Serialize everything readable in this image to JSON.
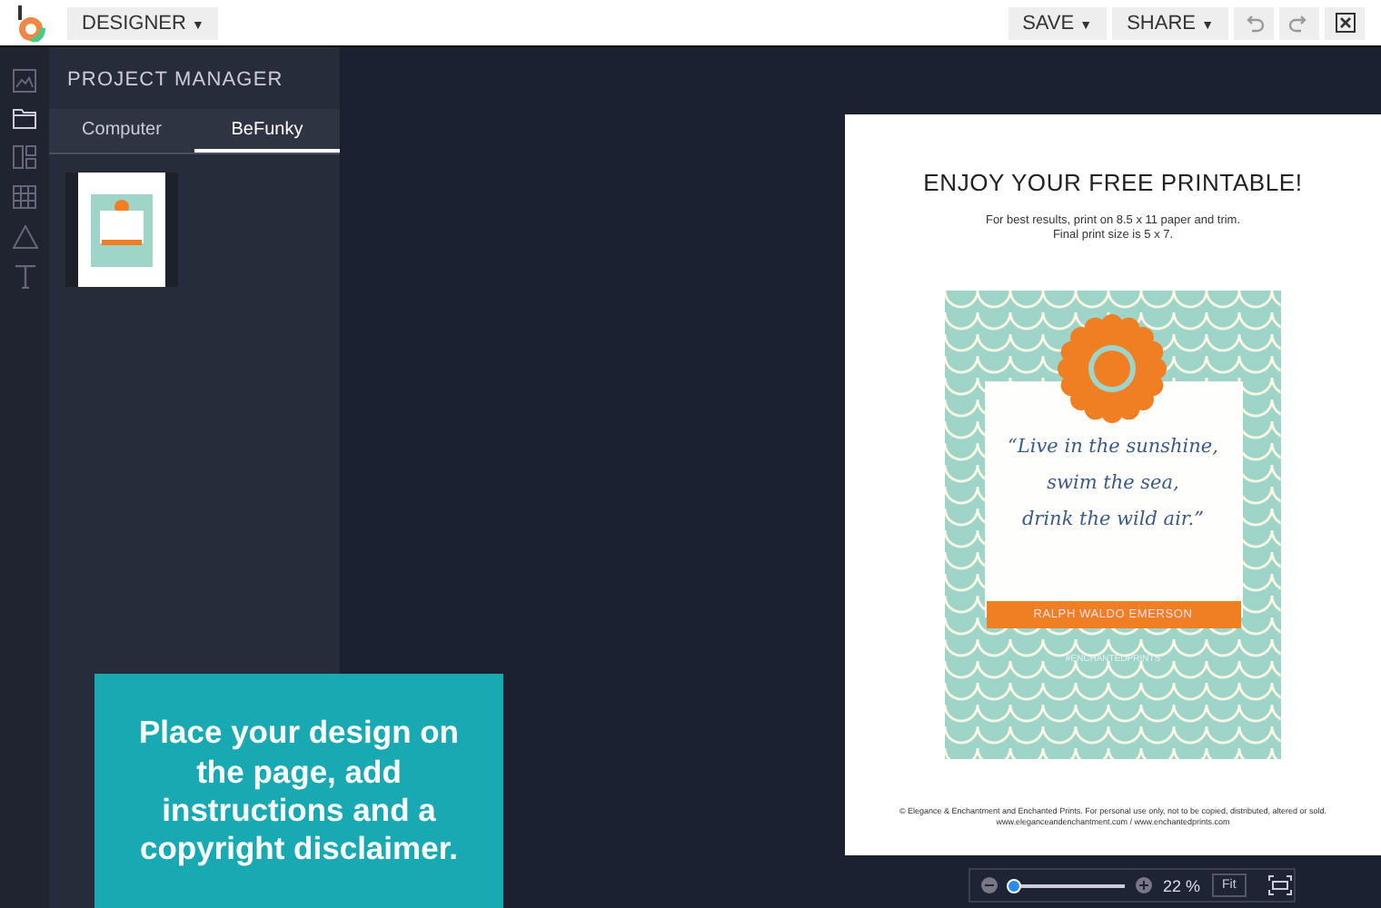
{
  "app_menu": {
    "label": "DESIGNER",
    "caret": "▼"
  },
  "toolbar": {
    "buttons": [
      {
        "label": "SAVE",
        "caret": "▼"
      },
      {
        "label": "SHARE",
        "caret": "▼"
      }
    ]
  },
  "panel": {
    "title": "PROJECT MANAGER",
    "tabs": [
      {
        "label": "Computer",
        "selected": false
      },
      {
        "label": "BeFunky",
        "selected": true
      }
    ]
  },
  "page": {
    "heading": "ENJOY YOUR FREE PRINTABLE!",
    "instructions": [
      "For best results, print on 8.5 x 11 paper and trim.",
      "Final print size is 5 x 7."
    ],
    "poster": {
      "quote": [
        "“Live in the sunshine,",
        "swim the sea,",
        "drink the wild air.”"
      ],
      "author": "RALPH WALDO EMERSON",
      "hashtag": "#ENCHANTEDPRINTS"
    },
    "footer": [
      "© Elegance & Enchantment and Enchanted Prints. For personal use only, not to be copied, distributed, altered or sold.",
      "www.eleganceandenchantment.com / www.enchantedprints.com"
    ]
  },
  "caption": "Place your design on the page, add instructions and a copyright disclaimer.",
  "zoom": {
    "level": 0.05,
    "reading": "22 %",
    "fit": "Fit"
  }
}
